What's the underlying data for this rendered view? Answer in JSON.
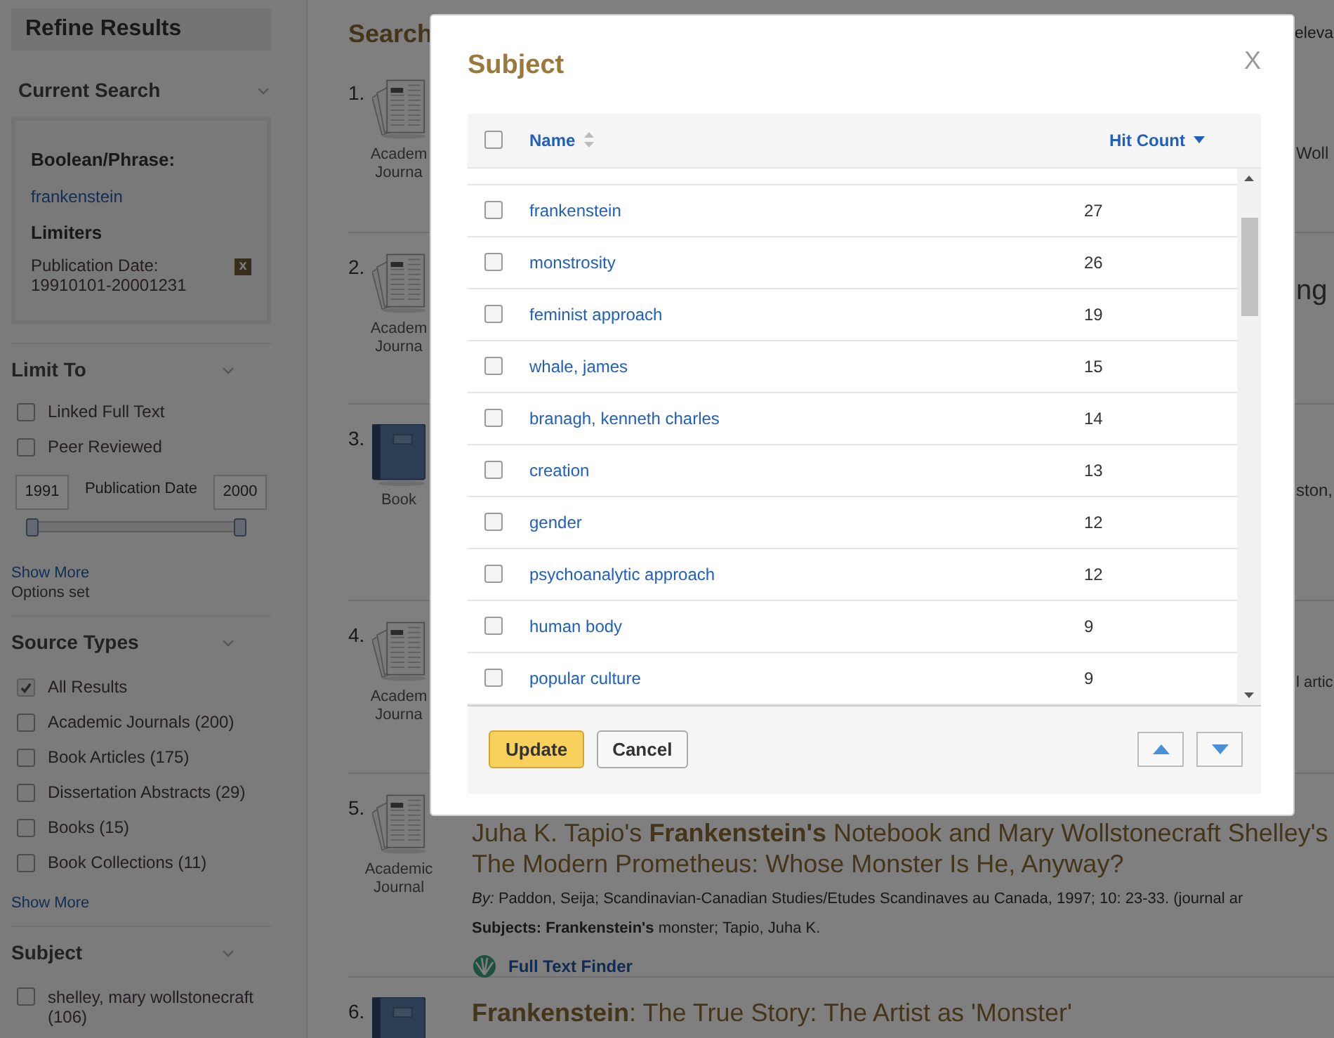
{
  "sidebar": {
    "title": "Refine Results",
    "current_search": {
      "heading": "Current Search",
      "boolean_label": "Boolean/Phrase:",
      "query": "frankenstein",
      "limiters_label": "Limiters",
      "limiter": "Publication Date: 19910101-20001231",
      "remove_label": "x"
    },
    "limit_to": {
      "heading": "Limit To",
      "options": [
        {
          "label": "Linked Full Text",
          "checked": false
        },
        {
          "label": "Peer Reviewed",
          "checked": false
        }
      ],
      "date": {
        "from": "1991",
        "label": "Publication Date",
        "to": "2000",
        "handles": [
          {
            "level": 0
          },
          {
            "level": 1
          }
        ]
      },
      "show_more": "Show More",
      "note": "Options set"
    },
    "source_types": {
      "heading": "Source Types",
      "options": [
        {
          "label": "All Results",
          "checked": true
        },
        {
          "label": "Academic Journals (200)",
          "checked": false
        },
        {
          "label": "Book Articles (175)",
          "checked": false
        },
        {
          "label": "Dissertation Abstracts (29)",
          "checked": false
        },
        {
          "label": "Books (15)",
          "checked": false
        },
        {
          "label": "Book Collections (11)",
          "checked": false
        }
      ],
      "show_more": "Show More"
    },
    "subject": {
      "heading": "Subject",
      "options": [
        {
          "label": "shelley, mary wollstonecraft (106)",
          "checked": false
        }
      ]
    }
  },
  "results": {
    "heading": "Search",
    "heading_tail": "eleva",
    "items": [
      {
        "number": "1.",
        "kind": "journal",
        "type": "Academ Journa",
        "fragment": "Woll"
      },
      {
        "number": "2.",
        "kind": "journal",
        "type": "Academ Journa",
        "fragment": "ng"
      },
      {
        "number": "3.",
        "kind": "book",
        "type": "Book",
        "fragment": "ston,"
      },
      {
        "number": "4.",
        "kind": "journal",
        "type": "Academ Journa",
        "fragment": "l artic"
      },
      {
        "number": "5.",
        "kind": "journal",
        "type": "Academic Journal",
        "title": [
          "Juha K. Tapio's **Frankenstein's** Notebook and Mary Wollstonecraft Shelley's",
          "The Modern Prometheus: Whose Monster Is He, Anyway?"
        ],
        "byline": "*By:* Paddon, Seija; Scandinavian-Canadian Studies/Etudes Scandinaves au Canada, 1997; 10: 23-33. (journal ar",
        "subjects": "**Subjects: Frankenstein's** monster; Tapio, Juha K.",
        "link": "Full Text Finder"
      },
      {
        "number": "6.",
        "kind": "book",
        "title": [
          "**Frankenstein**: The True Story: The Artist as 'Monster'"
        ]
      }
    ]
  },
  "dialog": {
    "title": "Subject",
    "close": "X",
    "select_all": {
      "checked": false
    },
    "columns": [
      {
        "label": "Name",
        "sorted": false
      },
      {
        "label": "Hit Count",
        "sorted": true
      }
    ],
    "rows": [
      {
        "name": "frankenstein",
        "count": "27",
        "checked": false
      },
      {
        "name": "monstrosity",
        "count": "26",
        "checked": false
      },
      {
        "name": "feminist approach",
        "count": "19",
        "checked": false
      },
      {
        "name": "whale, james",
        "count": "15",
        "checked": false
      },
      {
        "name": "branagh, kenneth charles",
        "count": "14",
        "checked": false
      },
      {
        "name": "creation",
        "count": "13",
        "checked": false
      },
      {
        "name": "gender",
        "count": "12",
        "checked": false
      },
      {
        "name": "psychoanalytic approach",
        "count": "12",
        "checked": false
      },
      {
        "name": "human body",
        "count": "9",
        "checked": false
      },
      {
        "name": "popular culture",
        "count": "9",
        "checked": false
      }
    ],
    "buttons": [
      {
        "label": "Update",
        "kind": "primary"
      },
      {
        "label": "Cancel",
        "kind": "secondary"
      }
    ]
  }
}
